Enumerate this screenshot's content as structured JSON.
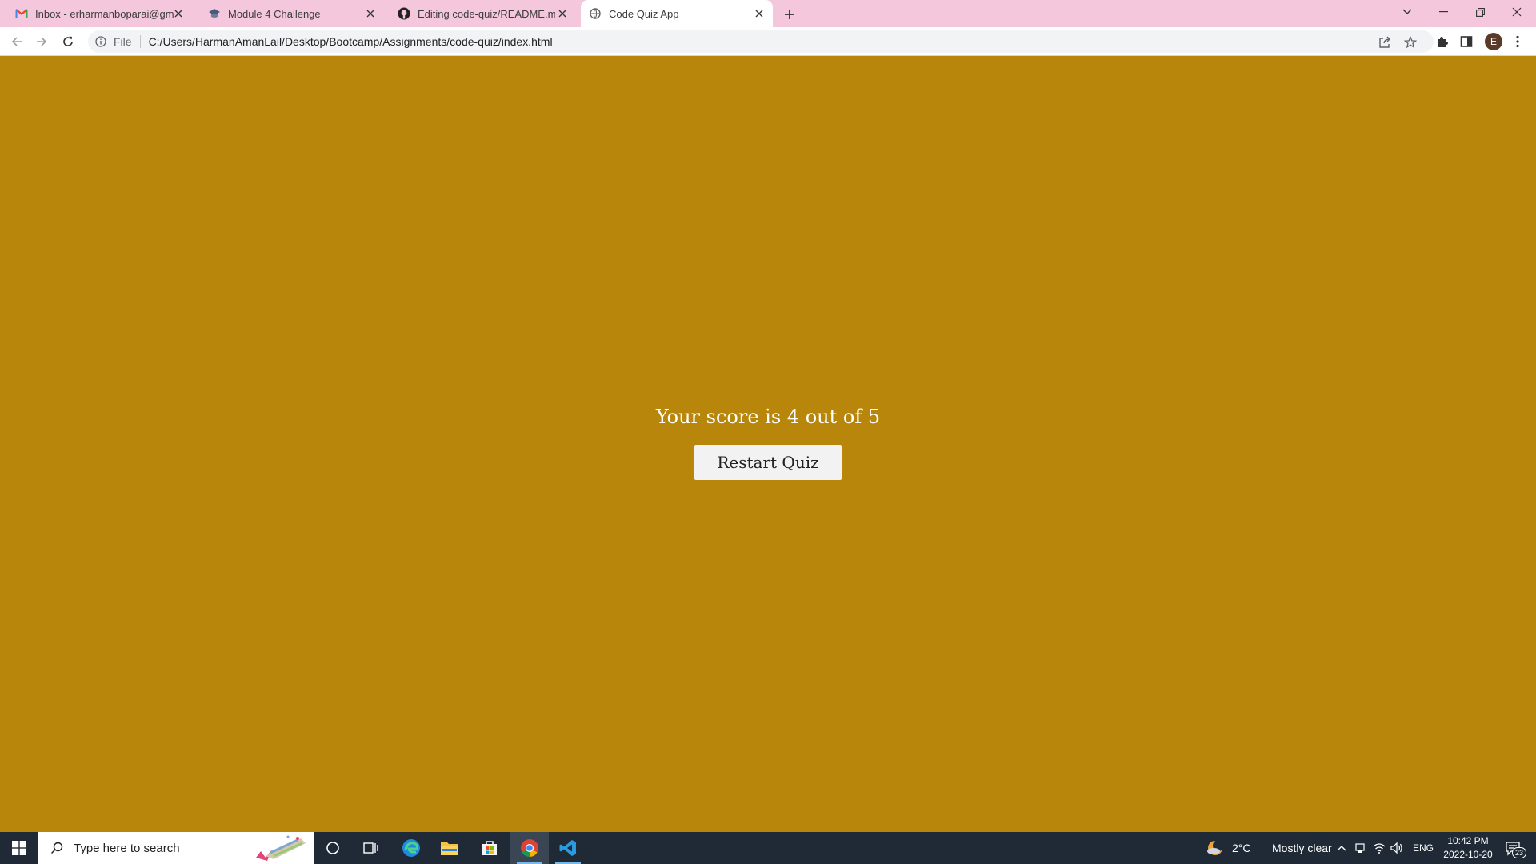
{
  "browser": {
    "tabs": [
      {
        "title": "Inbox - erharmanboparai@gmail.com",
        "icon": "gmail-icon",
        "active": false
      },
      {
        "title": "Module 4 Challenge",
        "icon": "bootcamp-icon",
        "active": false
      },
      {
        "title": "Editing code-quiz/README.md at main",
        "icon": "github-icon",
        "active": false
      },
      {
        "title": "Code Quiz App",
        "icon": "globe-icon",
        "active": true
      }
    ],
    "address": {
      "scheme_label": "File",
      "url": "C:/Users/HarmanAmanLail/Desktop/Bootcamp/Assignments/code-quiz/index.html"
    },
    "profile_initial": "E"
  },
  "page": {
    "score_text": "Your score is 4 out of 5",
    "restart_label": "Restart Quiz",
    "background_color": "#b8860b"
  },
  "taskbar": {
    "search_placeholder": "Type here to search",
    "weather": {
      "temp": "2°C",
      "condition": "Mostly clear"
    },
    "language": "ENG",
    "time": "10:42 PM",
    "date": "2022-10-20",
    "notification_count": "23"
  }
}
